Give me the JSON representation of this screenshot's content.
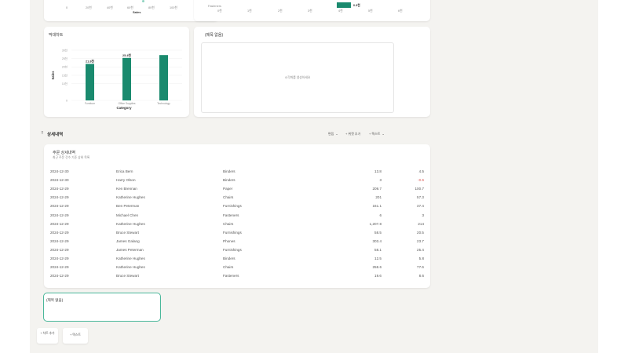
{
  "top_left_chart": {
    "xlabel": "Sales",
    "ticks": [
      "0",
      "20천",
      "40천",
      "60천",
      "80천",
      "100천"
    ]
  },
  "top_right_chart": {
    "category_label": "Fasteners",
    "value_label": "0.3천",
    "ticks": [
      "0천",
      "1천",
      "2천",
      "3천",
      "4천",
      "5천",
      "6천"
    ]
  },
  "bar_card": {
    "title": "막대차트",
    "chart_data": {
      "type": "bar",
      "categories": [
        "Furniture",
        "Office Supplies",
        "Technology"
      ],
      "values": [
        21.8,
        25.4,
        27.1
      ],
      "data_labels": [
        "21.8천",
        "25.4천",
        ""
      ],
      "xlabel": "Category",
      "ylabel": "Sales",
      "ylim": [
        0,
        30
      ],
      "yticks": [
        "30천",
        "25천",
        "20천",
        "15천",
        "10천",
        "0"
      ],
      "color": "#1a8a6e"
    }
  },
  "empty_card": {
    "title": "(제목 없음)",
    "placeholder": "시각화를 생성하세요"
  },
  "section": {
    "title": "상세내역",
    "actions": {
      "filter": "편집",
      "add": "+ 위젯 추가",
      "text": "+ 텍스트"
    }
  },
  "table_card": {
    "title": "주문 상세내역",
    "subtitle": "최근 주문 건수 기준 상위 목록",
    "rows": [
      [
        "2024-12-30",
        "Erica Bern",
        "Binders",
        "13.8",
        "4.5"
      ],
      [
        "2024-12-30",
        "Harry Olson",
        "Binders",
        "3",
        "-0.6"
      ],
      [
        "2024-12-29",
        "Ken Brennan",
        "Paper",
        "209.7",
        "100.7"
      ],
      [
        "2024-12-29",
        "Katherine Hughes",
        "Chairs",
        "201",
        "57.3"
      ],
      [
        "2024-12-29",
        "Ben Peterman",
        "Furnishings",
        "161.1",
        "37.4"
      ],
      [
        "2024-12-29",
        "Michael Chen",
        "Fasteners",
        "6",
        "3"
      ],
      [
        "2024-12-29",
        "Katherine Hughes",
        "Chairs",
        "1,207.8",
        "214"
      ],
      [
        "2024-12-29",
        "Bruce Stewart",
        "Furnishings",
        "58.5",
        "20.5"
      ],
      [
        "2024-12-29",
        "James Galang",
        "Phones",
        "303.4",
        "23.7"
      ],
      [
        "2024-12-29",
        "James Peterman",
        "Furnishings",
        "58.1",
        "25.4"
      ],
      [
        "2024-12-29",
        "Katherine Hughes",
        "Binders",
        "12.5",
        "5.8"
      ],
      [
        "2024-12-29",
        "Katherine Hughes",
        "Chairs",
        "258.6",
        "77.6"
      ],
      [
        "2024-12-29",
        "Bruce Stewart",
        "Fasteners",
        "19.6",
        "8.6"
      ]
    ]
  },
  "new_widget": {
    "title": "(제목 없음)"
  },
  "bottom_buttons": {
    "chart": "+ 차트 추가",
    "text": "+ 텍스트"
  },
  "colors": {
    "accent": "#1a8a6e",
    "negative": "#d9534f",
    "background": "#f4f3f0"
  }
}
